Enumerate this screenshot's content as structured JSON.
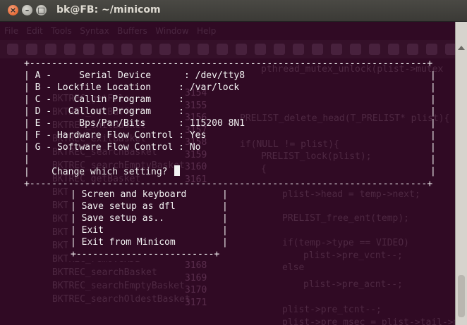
{
  "window": {
    "title": "bk@FB: ~/minicom"
  },
  "background_editor": {
    "menu": [
      "File",
      "Edit",
      "Tools",
      "Syntax",
      "Buffers",
      "Window",
      "Help"
    ],
    "code_lines": [
      "pthread_mutex_unlock(plist->mutex",
      "PRELIST_delete_head(T_PRELIST* plist){",
      "if(NULL != plist){",
      "PRELIST_lock(plist);",
      "{",
      "plist->head = temp->next;",
      "PRELIST_free_ent(temp);",
      "if(temp->type == VIDEO)",
      "plist->pre_vcnt--;",
      "else",
      "plist->pre_acnt--;",
      "plist->pre_tcnt--;",
      "plist->pre_msec = plist->tail->msec"
    ],
    "left_list": [
      "BKTREC_getFile",
      "BKTREC_setBuffer",
      "BKTREC_initBasket",
      "BKTREC_exitBasket",
      "BKTREC_searchBasket",
      "BKTREC_searchEmptyBasket",
      "BKTREC_getBasket",
      "BKTREC_putBasket",
      "BKTREC_freeBasket",
      "BKTREC_getPrevBasket",
      "BKTREC_getFreeBasket",
      "BKTREC_open",
      "BKTREC_removeRDB",
      "BKTREC_searchBasket",
      "BKTREC_searchEmptyBasket",
      "BKTREC_searchOldestBasket"
    ],
    "line_numbers": [
      "3154",
      "3155",
      "3156",
      "3157",
      "3158",
      "3159",
      "3160",
      "3161",
      "3162",
      "3163",
      "3164",
      "3165",
      "3166",
      "3167",
      "3168",
      "3169",
      "3170",
      "3171"
    ]
  },
  "config_dialog": {
    "border_top": "+-----------------------------------------------------------------------+",
    "options": [
      {
        "key": "A",
        "label": "    Serial Device      ",
        "value": "/dev/tty8"
      },
      {
        "key": "B",
        "label": "Lockfile Location     ",
        "value": "/var/lock"
      },
      {
        "key": "C",
        "label": "   Callin Program     ",
        "value": ""
      },
      {
        "key": "D",
        "label": "  Callout Program     ",
        "value": ""
      },
      {
        "key": "E",
        "label": "    Bps/Par/Bits      ",
        "value": "115200 8N1"
      },
      {
        "key": "F",
        "label": "Hardware Flow Control ",
        "value": "Yes"
      },
      {
        "key": "G",
        "label": "Software Flow Control ",
        "value": "No"
      }
    ],
    "prompt": "Change which setting?"
  },
  "main_menu": {
    "items": [
      "Screen and keyboard",
      "Save setup as dfl",
      "Save setup as..",
      "Exit",
      "Exit from Minicom"
    ]
  }
}
